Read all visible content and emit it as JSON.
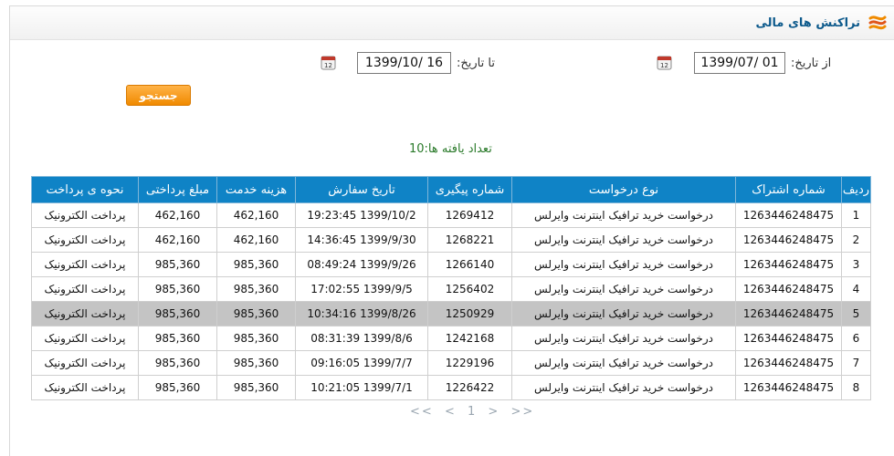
{
  "header": {
    "title": "تراکنش های مالی"
  },
  "filters": {
    "from_label": "از تاریخ:",
    "from_value": "1399/07/ 01",
    "to_label": "تا تاریخ:",
    "to_value": "1399/10/ 16",
    "search_label": "جستجو"
  },
  "result_count": "تعداد یافته ها:10",
  "table": {
    "columns": [
      "ردیف",
      "شماره اشتراک",
      "نوع درخواست",
      "شماره پیگیری",
      "تاریخ سفارش",
      "هزینه خدمت",
      "مبلغ پرداختی",
      "نحوه ی پرداخت"
    ],
    "rows": [
      [
        "1",
        "1263446248475",
        "درخواست خرید ترافیک اینترنت وایرلس",
        "1269412",
        "19:23:45 1399/10/2",
        "462,160",
        "462,160",
        "پرداخت الکترونیک"
      ],
      [
        "2",
        "1263446248475",
        "درخواست خرید ترافیک اینترنت وایرلس",
        "1268221",
        "14:36:45 1399/9/30",
        "462,160",
        "462,160",
        "پرداخت الکترونیک"
      ],
      [
        "3",
        "1263446248475",
        "درخواست خرید ترافیک اینترنت وایرلس",
        "1266140",
        "08:49:24 1399/9/26",
        "985,360",
        "985,360",
        "پرداخت الکترونیک"
      ],
      [
        "4",
        "1263446248475",
        "درخواست خرید ترافیک اینترنت وایرلس",
        "1256402",
        "17:02:55 1399/9/5",
        "985,360",
        "985,360",
        "پرداخت الکترونیک"
      ],
      [
        "5",
        "1263446248475",
        "درخواست خرید ترافیک اینترنت وایرلس",
        "1250929",
        "10:34:16 1399/8/26",
        "985,360",
        "985,360",
        "پرداخت الکترونیک"
      ],
      [
        "6",
        "1263446248475",
        "درخواست خرید ترافیک اینترنت وایرلس",
        "1242168",
        "08:31:39 1399/8/6",
        "985,360",
        "985,360",
        "پرداخت الکترونیک"
      ],
      [
        "7",
        "1263446248475",
        "درخواست خرید ترافیک اینترنت وایرلس",
        "1229196",
        "09:16:05 1399/7/7",
        "985,360",
        "985,360",
        "پرداخت الکترونیک"
      ],
      [
        "8",
        "1263446248475",
        "درخواست خرید ترافیک اینترنت وایرلس",
        "1226422",
        "10:21:05 1399/7/1",
        "985,360",
        "985,360",
        "پرداخت الکترونیک"
      ]
    ],
    "highlighted_row": 5
  },
  "pager": {
    "first": "<<",
    "prev": "<",
    "current": "1",
    "next": ">",
    "last": ">>"
  },
  "colors": {
    "header_bg": "#0f83c6",
    "title": "#0d5a8c",
    "button": "#f08a00",
    "count": "#2a7a2a",
    "highlight": "#c4c4c4"
  }
}
